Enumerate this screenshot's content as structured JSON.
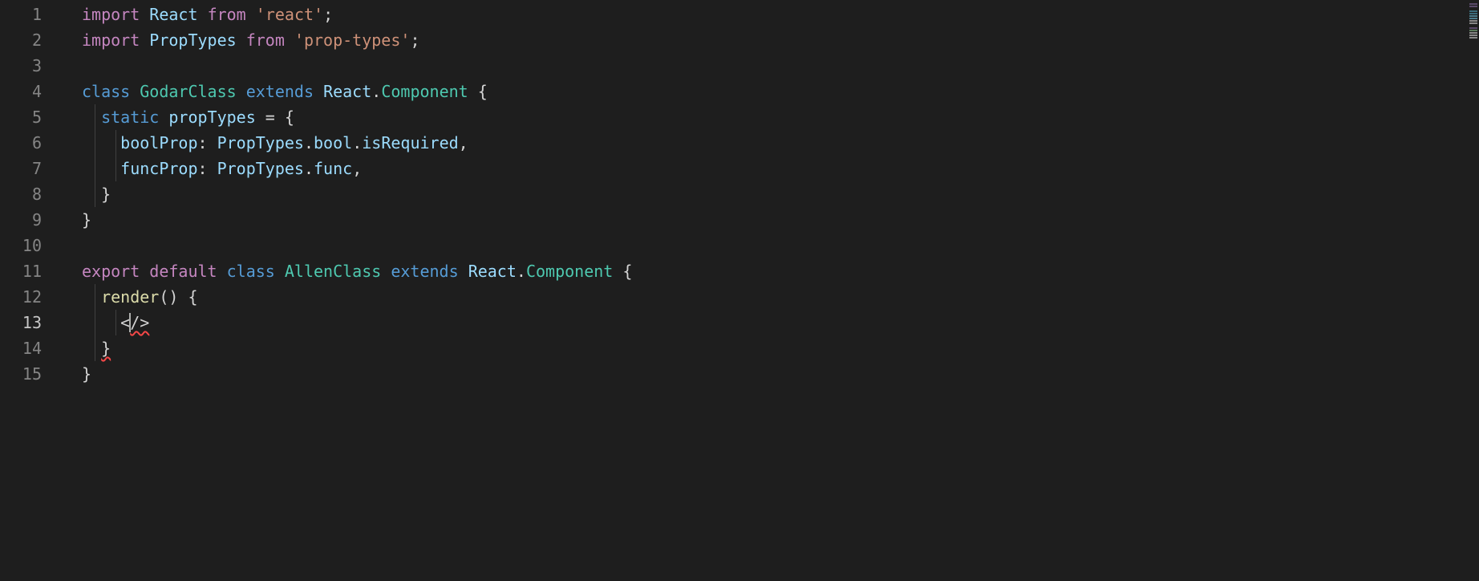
{
  "editor": {
    "activeLine": 13,
    "lineNumbers": [
      "1",
      "2",
      "3",
      "4",
      "5",
      "6",
      "7",
      "8",
      "9",
      "10",
      "11",
      "12",
      "13",
      "14",
      "15"
    ],
    "lines": [
      {
        "tokens": [
          {
            "t": "import ",
            "c": "kw-import"
          },
          {
            "t": "React",
            "c": "ident"
          },
          {
            "t": " ",
            "c": "plain"
          },
          {
            "t": "from",
            "c": "kw-from"
          },
          {
            "t": " ",
            "c": "plain"
          },
          {
            "t": "'react'",
            "c": "str"
          },
          {
            "t": ";",
            "c": "punct"
          }
        ]
      },
      {
        "tokens": [
          {
            "t": "import ",
            "c": "kw-import"
          },
          {
            "t": "PropTypes",
            "c": "ident"
          },
          {
            "t": " ",
            "c": "plain"
          },
          {
            "t": "from",
            "c": "kw-from"
          },
          {
            "t": " ",
            "c": "plain"
          },
          {
            "t": "'prop-types'",
            "c": "str"
          },
          {
            "t": ";",
            "c": "punct"
          }
        ]
      },
      {
        "tokens": []
      },
      {
        "tokens": [
          {
            "t": "class ",
            "c": "kw-class"
          },
          {
            "t": "GodarClass",
            "c": "typename"
          },
          {
            "t": " ",
            "c": "plain"
          },
          {
            "t": "extends",
            "c": "kw-extends"
          },
          {
            "t": " ",
            "c": "plain"
          },
          {
            "t": "React",
            "c": "ident"
          },
          {
            "t": ".",
            "c": "punct"
          },
          {
            "t": "Component",
            "c": "typename"
          },
          {
            "t": " {",
            "c": "punct"
          }
        ]
      },
      {
        "guides": [
          "g1"
        ],
        "tokens": [
          {
            "t": "  ",
            "c": "plain"
          },
          {
            "t": "static ",
            "c": "kw-static"
          },
          {
            "t": "propTypes",
            "c": "prop"
          },
          {
            "t": " = {",
            "c": "punct"
          }
        ]
      },
      {
        "guides": [
          "g1",
          "g2"
        ],
        "tokens": [
          {
            "t": "    ",
            "c": "plain"
          },
          {
            "t": "boolProp",
            "c": "prop"
          },
          {
            "t": ": ",
            "c": "punct"
          },
          {
            "t": "PropTypes",
            "c": "ident"
          },
          {
            "t": ".",
            "c": "punct"
          },
          {
            "t": "bool",
            "c": "member"
          },
          {
            "t": ".",
            "c": "punct"
          },
          {
            "t": "isRequired",
            "c": "member"
          },
          {
            "t": ",",
            "c": "punct"
          }
        ]
      },
      {
        "guides": [
          "g1",
          "g2"
        ],
        "tokens": [
          {
            "t": "    ",
            "c": "plain"
          },
          {
            "t": "funcProp",
            "c": "prop"
          },
          {
            "t": ": ",
            "c": "punct"
          },
          {
            "t": "PropTypes",
            "c": "ident"
          },
          {
            "t": ".",
            "c": "punct"
          },
          {
            "t": "func",
            "c": "member"
          },
          {
            "t": ",",
            "c": "punct"
          }
        ]
      },
      {
        "guides": [
          "g1"
        ],
        "tokens": [
          {
            "t": "  }",
            "c": "punct"
          }
        ]
      },
      {
        "tokens": [
          {
            "t": "}",
            "c": "punct"
          }
        ]
      },
      {
        "tokens": []
      },
      {
        "tokens": [
          {
            "t": "export ",
            "c": "kw-export"
          },
          {
            "t": "default ",
            "c": "kw-default"
          },
          {
            "t": "class ",
            "c": "kw-class"
          },
          {
            "t": "AllenClass",
            "c": "typename"
          },
          {
            "t": " ",
            "c": "plain"
          },
          {
            "t": "extends",
            "c": "kw-extends"
          },
          {
            "t": " ",
            "c": "plain"
          },
          {
            "t": "React",
            "c": "ident"
          },
          {
            "t": ".",
            "c": "punct"
          },
          {
            "t": "Component",
            "c": "typename"
          },
          {
            "t": " {",
            "c": "punct"
          }
        ]
      },
      {
        "guides": [
          "g1"
        ],
        "tokens": [
          {
            "t": "  ",
            "c": "plain"
          },
          {
            "t": "render",
            "c": "func"
          },
          {
            "t": "() {",
            "c": "punct"
          }
        ]
      },
      {
        "guides": [
          "g1",
          "g2"
        ],
        "cursorAt": 1,
        "tokens": [
          {
            "t": "    ",
            "c": "plain"
          },
          {
            "t": "<",
            "c": "punct"
          },
          {
            "t": "/>",
            "c": "punct",
            "error": true
          }
        ]
      },
      {
        "guides": [
          "g1"
        ],
        "tokens": [
          {
            "t": "  ",
            "c": "plain"
          },
          {
            "t": "}",
            "c": "punct",
            "error": true
          }
        ]
      },
      {
        "tokens": [
          {
            "t": "}",
            "c": "punct"
          }
        ]
      }
    ]
  },
  "colors": {
    "bg": "#1e1e1e",
    "gutter": "#858585",
    "gutterActive": "#c6c6c6",
    "keyword": "#c586c0",
    "storage": "#569cd6",
    "type": "#4ec9b0",
    "identifier": "#9cdcfe",
    "function": "#dcdcaa",
    "string": "#ce9178",
    "default": "#d4d4d4",
    "error": "#f44747"
  }
}
